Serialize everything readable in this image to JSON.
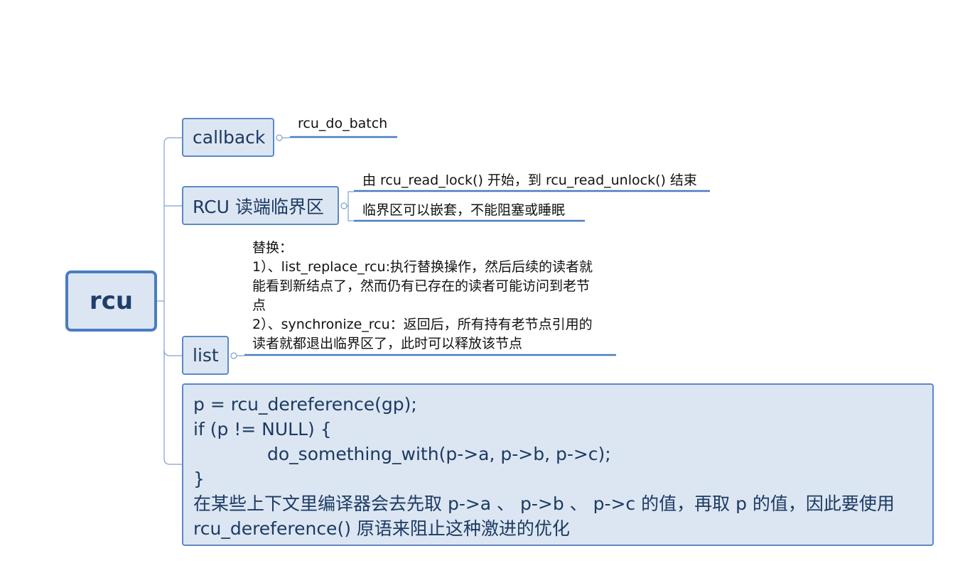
{
  "root": {
    "label": "rcu"
  },
  "topics": {
    "callback": {
      "label": "callback",
      "children": [
        "rcu_do_batch"
      ]
    },
    "rcu_read": {
      "label": "RCU 读端临界区",
      "children": [
        "由 rcu_read_lock() 开始，到 rcu_read_unlock() 结束",
        "临界区可以嵌套，不能阻塞或睡眠"
      ]
    },
    "list": {
      "label": "list",
      "note_lines": [
        "替换：",
        "1）、list_replace_rcu:执行替换操作，然后后续的读者就",
        "能看到新结点了，然而仍有已存在的读者可能访问到老节",
        "点",
        "2）、synchronize_rcu：返回后，所有持有老节点引用的",
        "读者就都退出临界区了，此时可以释放该节点"
      ]
    },
    "code": {
      "lines": [
        "p = rcu_dereference(gp);",
        "if (p != NULL) {",
        "do_something_with(p->a, p->b, p->c);",
        "}",
        "在某些上下文里编译器会去先取 p->a 、 p->b 、 p->c 的值，再取 p 的值，因此要使用",
        "rcu_dereference() 原语来阻止这种激进的优化"
      ]
    }
  },
  "colors": {
    "node_fill": "#dce6f2",
    "node_border": "#5b8ac6",
    "root_border": "#4a7cbf",
    "line": "#4a7cbf",
    "text": "#1c3a63"
  }
}
